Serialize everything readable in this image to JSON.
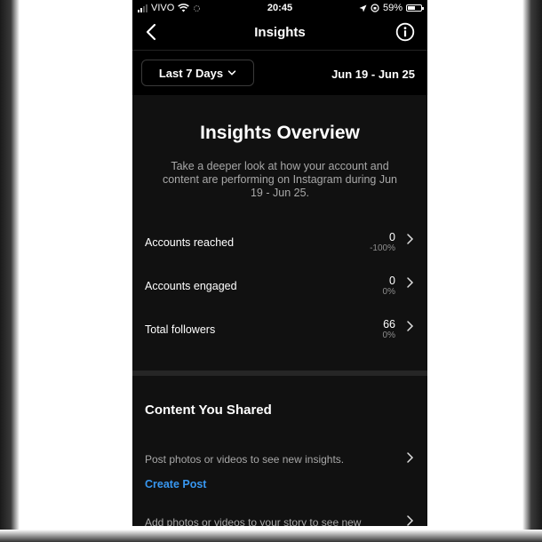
{
  "status_bar": {
    "carrier": "VIVO",
    "time": "20:45",
    "battery_percent": "59%",
    "battery_level": 0.59
  },
  "header": {
    "title": "Insights",
    "back_icon": "chevron-left-icon",
    "info_icon": "info-icon"
  },
  "date_filter": {
    "range_label": "Last 7 Days",
    "date_range": "Jun 19 - Jun 25"
  },
  "overview": {
    "title": "Insights Overview",
    "description": "Take a deeper look at how your account and content are performing on Instagram during Jun 19 - Jun 25."
  },
  "metrics": [
    {
      "label": "Accounts reached",
      "value": "0",
      "change": "-100%"
    },
    {
      "label": "Accounts engaged",
      "value": "0",
      "change": "0%"
    },
    {
      "label": "Total followers",
      "value": "66",
      "change": "0%"
    }
  ],
  "content_shared": {
    "title": "Content You Shared",
    "posts_empty": "Post photos or videos to see new insights.",
    "create_post": "Create Post",
    "story_empty": "Add photos or videos to your story to see new"
  },
  "colors": {
    "background": "#000000",
    "panel": "#111111",
    "link": "#3897f0",
    "secondary_text": "#a8a8a8"
  }
}
